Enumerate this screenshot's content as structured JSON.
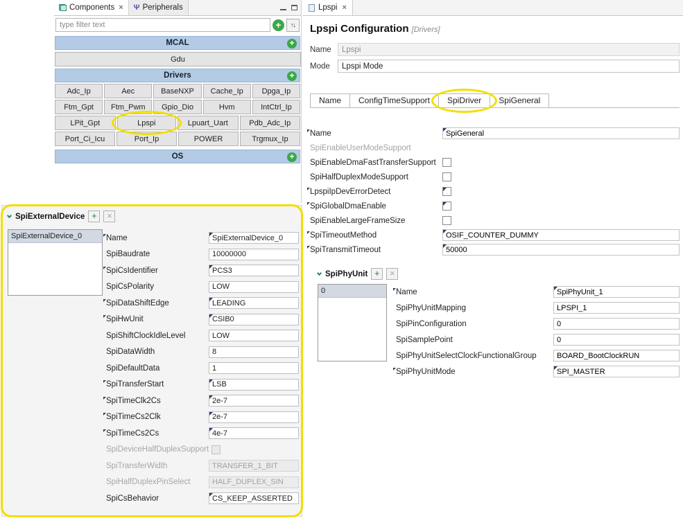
{
  "components_panel": {
    "tabs": [
      {
        "label": "Components"
      },
      {
        "label": "Peripherals"
      }
    ],
    "filter_placeholder": "type filter text",
    "categories": [
      "MCAL",
      "Drivers",
      "OS"
    ],
    "mcal_items": [
      "Gdu"
    ],
    "driver_rows": [
      [
        "Adc_Ip",
        "Aec",
        "BaseNXP",
        "Cache_Ip",
        "Dpga_Ip"
      ],
      [
        "Ftm_Gpt",
        "Ftm_Pwm",
        "Gpio_Dio",
        "Hvm",
        "IntCtrl_Ip"
      ],
      [
        "LPit_Gpt",
        "Lpspi",
        "Lpuart_Uart",
        "Pdb_Adc_Ip"
      ],
      [
        "Port_Ci_Icu",
        "Port_Ip",
        "POWER",
        "Trgmux_Ip"
      ]
    ]
  },
  "editor": {
    "tab_label": "Lpspi",
    "title": "Lpspi Configuration",
    "title_suffix": "[Drivers]",
    "name_label": "Name",
    "name_value": "Lpspi",
    "mode_label": "Mode",
    "mode_value": "Lpspi Mode",
    "subtabs": [
      "Name",
      "ConfigTimeSupport",
      "SpiDriver",
      "SpiGeneral"
    ],
    "general_fields": [
      {
        "label": "Name",
        "value": "SpiGeneral"
      },
      {
        "label": "SpiEnableUserModeSupport",
        "checked": false
      },
      {
        "label": "SpiEnableDmaFastTransferSupport",
        "checked": false
      },
      {
        "label": "SpiHalfDuplexModeSupport",
        "checked": false
      },
      {
        "label": "LpspiIpDevErrorDetect",
        "checked": false
      },
      {
        "label": "SpiGlobalDmaEnable",
        "checked": false
      },
      {
        "label": "SpiEnableLargeFrameSize",
        "checked": false
      },
      {
        "label": "SpiTimeoutMethod",
        "value": "OSIF_COUNTER_DUMMY"
      },
      {
        "label": "SpiTransmitTimeout",
        "value": "50000"
      }
    ],
    "spi_phy_unit": {
      "title": "SpiPhyUnit",
      "add_label": "+",
      "remove_label": "×",
      "list_items": [
        "0"
      ],
      "fields": [
        {
          "label": "Name",
          "value": "SpiPhyUnit_1"
        },
        {
          "label": "SpiPhyUnitMapping",
          "value": "LPSPI_1"
        },
        {
          "label": "SpiPinConfiguration",
          "value": "0"
        },
        {
          "label": "SpiSamplePoint",
          "value": "0"
        },
        {
          "label": "SpiPhyUnitSelectClockFunctionalGroup",
          "value": "BOARD_BootClockRUN"
        },
        {
          "label": "SpiPhyUnitMode",
          "value": "SPI_MASTER"
        }
      ]
    }
  },
  "spi_external_device": {
    "title": "SpiExternalDevice",
    "add_label": "+",
    "remove_label": "×",
    "list_items": [
      "SpiExternalDevice_0"
    ],
    "fields": [
      {
        "label": "Name",
        "value": "SpiExternalDevice_0"
      },
      {
        "label": "SpiBaudrate",
        "value": "10000000"
      },
      {
        "label": "SpiCsIdentifier",
        "value": "PCS3"
      },
      {
        "label": "SpiCsPolarity",
        "value": "LOW"
      },
      {
        "label": "SpiDataShiftEdge",
        "value": "LEADING"
      },
      {
        "label": "SpiHwUnit",
        "value": "CSIB0"
      },
      {
        "label": "SpiShiftClockIdleLevel",
        "value": "LOW"
      },
      {
        "label": "SpiDataWidth",
        "value": "8"
      },
      {
        "label": "SpiDefaultData",
        "value": "1"
      },
      {
        "label": "SpiTransferStart",
        "value": "LSB"
      },
      {
        "label": "SpiTimeClk2Cs",
        "value": "2e-7"
      },
      {
        "label": "SpiTimeCs2Clk",
        "value": "2e-7"
      },
      {
        "label": "SpiTimeCs2Cs",
        "value": "4e-7"
      },
      {
        "label": "SpiDeviceHalfDuplexSupport",
        "checked": false
      },
      {
        "label": "SpiTransferWidth",
        "value": "TRANSFER_1_BIT"
      },
      {
        "label": "SpiHalfDuplexPinSelect",
        "value": "HALF_DUPLEX_SIN"
      },
      {
        "label": "SpiCsBehavior",
        "value": "CS_KEEP_ASSERTED"
      }
    ],
    "highlight_color": "#f2de00"
  }
}
